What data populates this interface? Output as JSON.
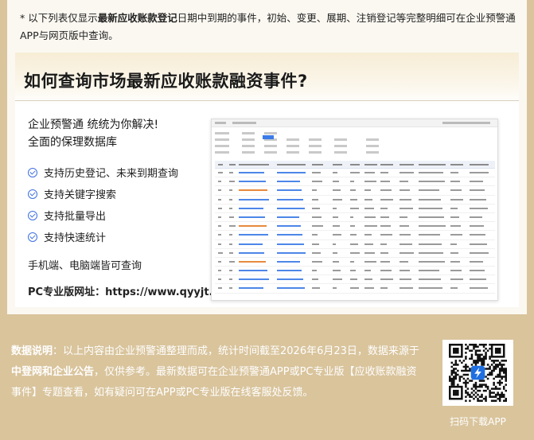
{
  "note": {
    "prefix": "* 以下列表仅显示",
    "bold": "最新应收账款登记",
    "suffix": "日期中到期的事件，初始、变更、展期、注销登记等完整明细可在企业预警通APP与网页版中查询。"
  },
  "promo": {
    "title": "如何查询市场最新应收账款融资事件?",
    "tagline_1": "企业预警通 统统为你解决!",
    "tagline_2": "全面的保理数据库",
    "features": [
      "支持历史登记、未来到期查询",
      "支持关键字搜索",
      "支持批量导出",
      "支持快速统计"
    ],
    "multi_device": "手机端、电脑端皆可查询",
    "pc_url_label": "PC专业版网址：",
    "pc_url": "https://www.qyyjt.cn"
  },
  "disclaimer": {
    "label": "数据说明",
    "t1": "：以上内容由企业预警通整理而成，统计时间截至2026年6月23日，数据来源于",
    "source": "中登网和企业公告",
    "t2": "，仅供参考。最新数据可在企业预警通APP或PC专业版【应收账款融资事件】专题查看，如有疑问可在APP或PC专业版在线客服处反馈。"
  },
  "qr": {
    "label": "扫码下载APP",
    "icon": "lightning-icon",
    "accent": "#1f6fe0"
  },
  "colors": {
    "bg": "#d9c49c",
    "card": "#fbf8f1",
    "check": "#3f6fe0"
  }
}
